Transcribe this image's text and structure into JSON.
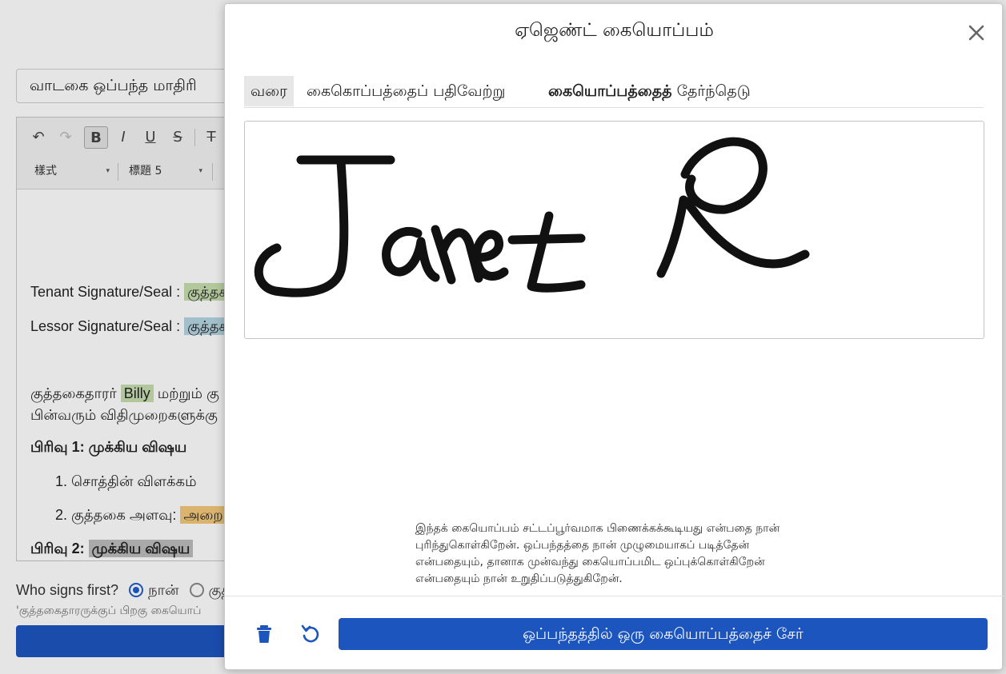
{
  "background": {
    "template_name": "வாடகை ஒப்பந்த மாதிரி",
    "toolbar": {
      "undo_icon": "undo-icon",
      "redo_icon": "redo-icon",
      "bold": "B",
      "italic": "I",
      "underline": "U",
      "strike": "S",
      "clear_format": "T",
      "style_select": "樣式",
      "heading_select": "標題 5"
    },
    "doc": {
      "tenant_label": "Tenant Signature/Seal : ",
      "tenant_tag": "குத்தக",
      "lessor_label": "Lessor Signature/Seal : ",
      "lessor_tag": "குத்தக",
      "para_start": "குத்தகைதாரர் ",
      "para_name": "Billy",
      "para_rest": " மற்றும் கு",
      "para_line2": "பின்வரும் விதிமுறைகளுக்கு",
      "section1": "பிரிவு 1: முக்கிய விஷய",
      "item1": "1. சொத்தின் விளக்கம்",
      "item2_label": "2. குத்தகை அளவு: ",
      "item2_tag": "அறை",
      "section2_label": "பிரிவு 2: ",
      "section2_tag": "முக்கிய விஷய"
    },
    "who_signs_label": "Who signs first?",
    "option_me": "நான்",
    "option_tenant": "குத்",
    "order_note": "'குத்தகைதாரருக்குப் பிறகு கையொப்"
  },
  "modal": {
    "title": "ஏஜெண்ட் கையொப்பம்",
    "close_icon": "close-icon",
    "tabs": {
      "draw": "வரை",
      "upload": "கைகொப்பத்தைப் பதிவேற்று",
      "choose_bold": "கையொப்பத்தைத்",
      "choose_rest": " தேர்ந்தெடு"
    },
    "signature_text": "Janet R",
    "consent_text": "இந்தக் கையொப்பம் சட்டப்பூர்வமாக பிணைக்கக்கூடியது என்பதை நான் புரிந்துகொள்கிறேன். ஒப்பந்தத்தை நான் முழுமையாகப் படித்தேன் என்பதையும், தானாக முன்வந்து கையொப்பமிட ஒப்புக்கொள்கிறேன் என்பதையும் நான் உறுதிப்படுத்துகிறேன்.",
    "trash_icon": "trash-icon",
    "undo_icon": "undo-icon",
    "add_button": "ஒப்பந்தத்தில் ஒரு கையொப்பத்தைச் சேர்",
    "accent_color": "#1d55bf"
  }
}
